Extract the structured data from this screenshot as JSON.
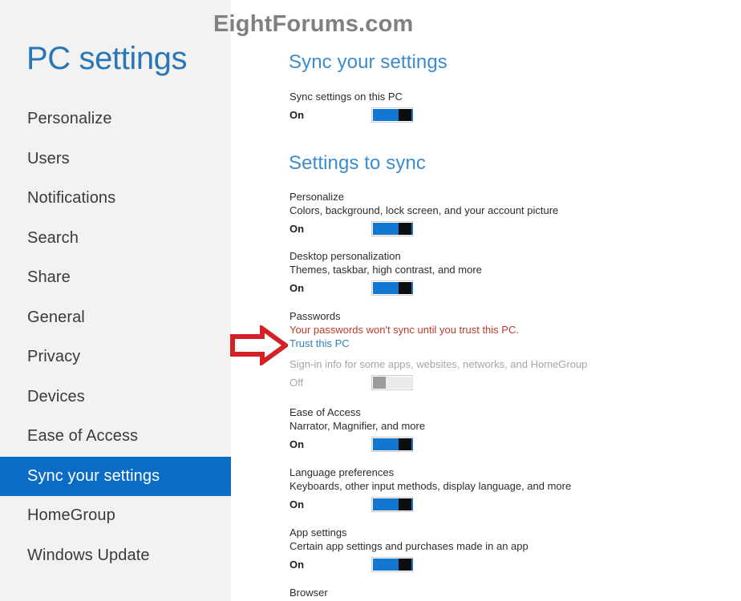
{
  "watermark": "EightForums.com",
  "sidebar": {
    "title": "PC settings",
    "items": [
      {
        "label": "Personalize",
        "selected": false
      },
      {
        "label": "Users",
        "selected": false
      },
      {
        "label": "Notifications",
        "selected": false
      },
      {
        "label": "Search",
        "selected": false
      },
      {
        "label": "Share",
        "selected": false
      },
      {
        "label": "General",
        "selected": false
      },
      {
        "label": "Privacy",
        "selected": false
      },
      {
        "label": "Devices",
        "selected": false
      },
      {
        "label": "Ease of Access",
        "selected": false
      },
      {
        "label": "Sync your settings",
        "selected": true
      },
      {
        "label": "HomeGroup",
        "selected": false
      },
      {
        "label": "Windows Update",
        "selected": false
      }
    ]
  },
  "main": {
    "heading_sync": "Sync your settings",
    "heading_settings_to_sync": "Settings to sync",
    "sync_on_this_pc": {
      "title": "Sync settings on this PC",
      "state_label": "On",
      "state": "on"
    },
    "settings": [
      {
        "title": "Personalize",
        "desc": "Colors, background, lock screen, and your account picture",
        "state_label": "On",
        "state": "on"
      },
      {
        "title": "Desktop personalization",
        "desc": "Themes, taskbar, high contrast, and more",
        "state_label": "On",
        "state": "on"
      },
      {
        "title": "Passwords",
        "warning": "Your passwords won't sync until you trust this PC.",
        "link": "Trust this PC",
        "desc": "Sign-in info for some apps, websites, networks, and HomeGroup",
        "desc_muted": true,
        "state_label": "Off",
        "state": "off",
        "disabled": true
      },
      {
        "title": "Ease of Access",
        "desc": "Narrator, Magnifier, and more",
        "state_label": "On",
        "state": "on"
      },
      {
        "title": "Language preferences",
        "desc": "Keyboards, other input methods, display language, and more",
        "state_label": "On",
        "state": "on"
      },
      {
        "title": "App settings",
        "desc": "Certain app settings and purchases made in an app",
        "state_label": "On",
        "state": "on"
      },
      {
        "title": "Browser",
        "desc": "",
        "state_label": "",
        "state": "none"
      }
    ]
  },
  "annotation": {
    "arrow_color": "#d42026",
    "arrow_direction": "right"
  },
  "colors": {
    "accent_blue": "#0a6cc4",
    "heading_blue": "#3c8ccd",
    "title_blue": "#2b77b5",
    "link_blue": "#2f7fc4",
    "warning_red": "#bc3a2a",
    "sidebar_bg": "#f2f2f2",
    "watermark_gray": "#808080"
  }
}
